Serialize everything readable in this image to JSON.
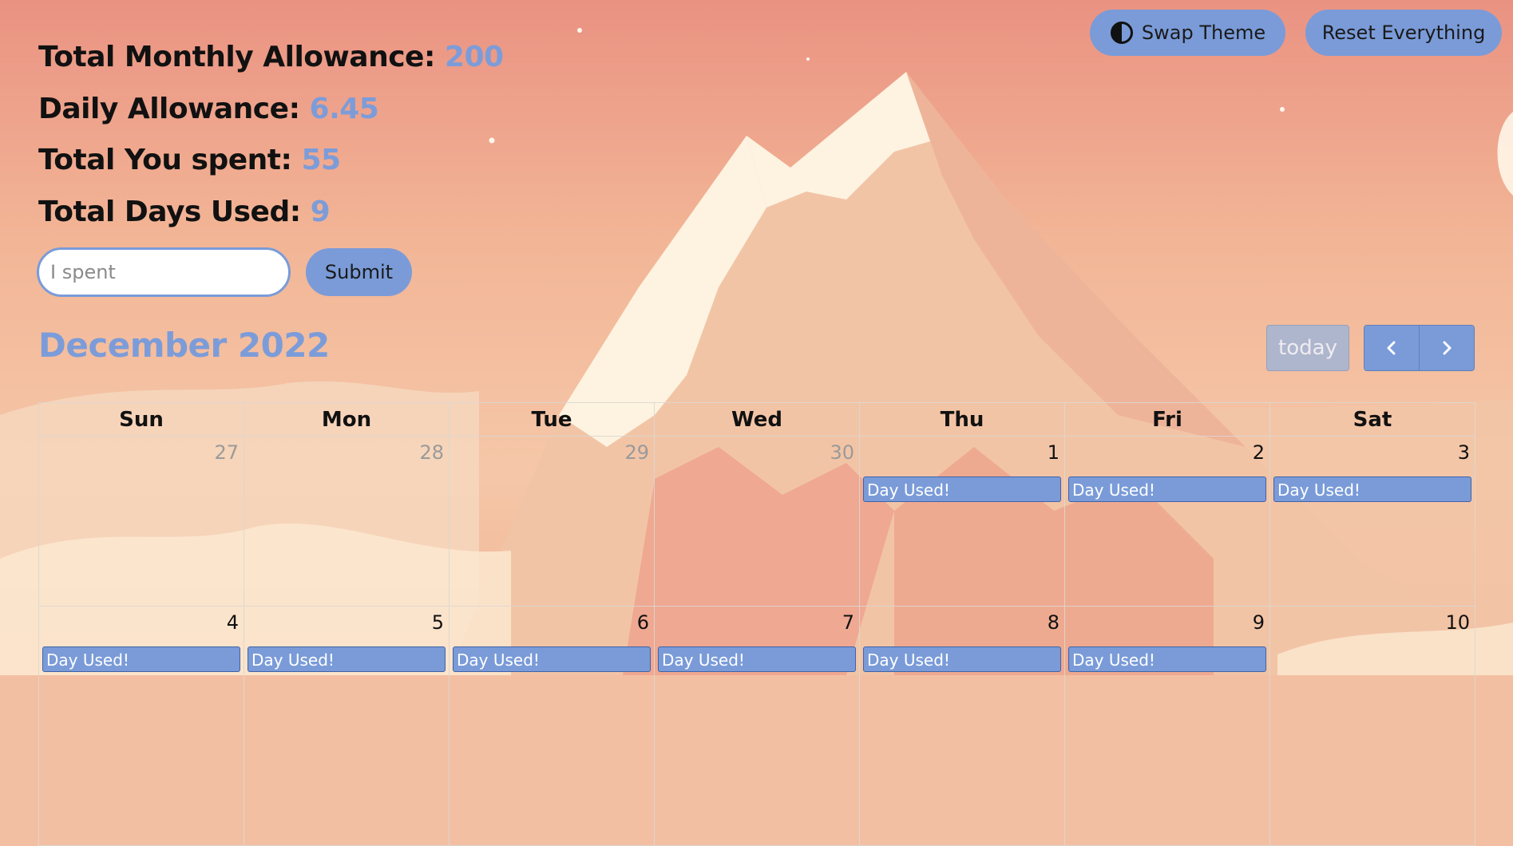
{
  "stats": [
    {
      "label": "Total Monthly Allowance:",
      "value": "200"
    },
    {
      "label": "Daily Allowance:",
      "value": "6.45"
    },
    {
      "label": "Total You spent:",
      "value": "55"
    },
    {
      "label": "Total Days Used:",
      "value": "9"
    }
  ],
  "form": {
    "placeholder": "I spent",
    "submit_label": "Submit"
  },
  "header": {
    "swap_label": "Swap Theme",
    "reset_label": "Reset Everything"
  },
  "calendar": {
    "title": "December 2022",
    "today_label": "today",
    "days": [
      "Sun",
      "Mon",
      "Tue",
      "Wed",
      "Thu",
      "Fri",
      "Sat"
    ],
    "event_label": "Day Used!",
    "weeks": [
      [
        {
          "num": "27",
          "other": true,
          "event": false
        },
        {
          "num": "28",
          "other": true,
          "event": false
        },
        {
          "num": "29",
          "other": true,
          "event": false
        },
        {
          "num": "30",
          "other": true,
          "event": false
        },
        {
          "num": "1",
          "other": false,
          "event": true
        },
        {
          "num": "2",
          "other": false,
          "event": true
        },
        {
          "num": "3",
          "other": false,
          "event": true
        }
      ],
      [
        {
          "num": "4",
          "other": false,
          "event": true
        },
        {
          "num": "5",
          "other": false,
          "event": true
        },
        {
          "num": "6",
          "other": false,
          "event": true
        },
        {
          "num": "7",
          "other": false,
          "event": true
        },
        {
          "num": "8",
          "other": false,
          "event": true
        },
        {
          "num": "9",
          "other": false,
          "event": true
        },
        {
          "num": "10",
          "other": false,
          "event": false
        }
      ]
    ]
  },
  "icons": {
    "theme": "contrast-icon",
    "prev": "chevron-left-icon",
    "next": "chevron-right-icon"
  },
  "colors": {
    "accent": "#7a9bd8",
    "value_text": "#7c9cd9",
    "event_border": "#3f63a8"
  }
}
